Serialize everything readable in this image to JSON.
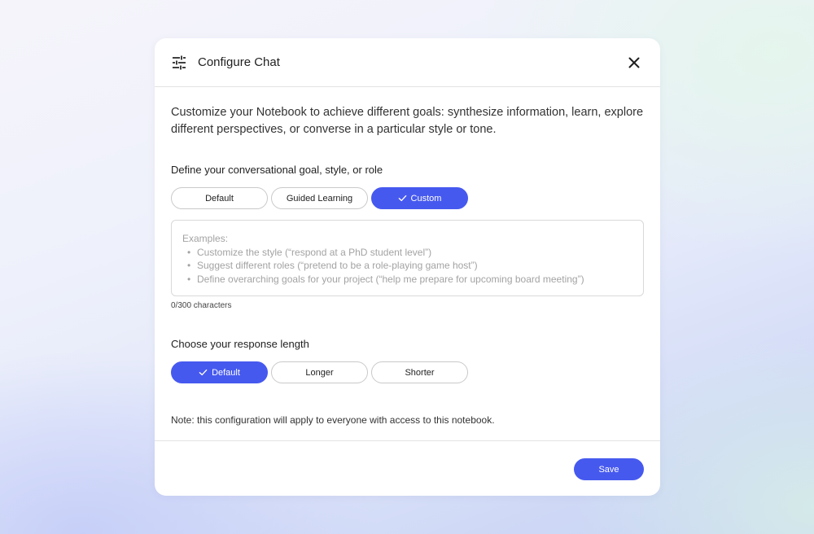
{
  "dialog": {
    "title": "Configure Chat",
    "icons": {
      "header": "tune-icon",
      "close": "close-icon",
      "selected": "check-icon"
    },
    "intro": "Customize your Notebook to achieve different goals: synthesize information, learn, explore different perspectives, or converse in a particular style or tone.",
    "goal": {
      "label": "Define your conversational goal, style, or role",
      "options": [
        {
          "label": "Default",
          "selected": false
        },
        {
          "label": "Guided Learning",
          "selected": false
        },
        {
          "label": "Custom",
          "selected": true
        }
      ],
      "textarea": {
        "value": "",
        "placeholder_heading": "Examples:",
        "placeholder_items": [
          "Customize the style (“respond at a PhD student level”)",
          "Suggest different roles (“pretend to be a role-playing game host”)",
          "Define overarching goals for your project (“help me prepare for upcoming board meeting”)"
        ]
      },
      "char_count": "0/300 characters"
    },
    "length": {
      "label": "Choose your response length",
      "options": [
        {
          "label": "Default",
          "selected": true
        },
        {
          "label": "Longer",
          "selected": false
        },
        {
          "label": "Shorter",
          "selected": false
        }
      ]
    },
    "note": "Note: this configuration will apply to everyone with access to this notebook.",
    "save_label": "Save"
  },
  "colors": {
    "accent": "#4659ef",
    "border": "#c9c9c9",
    "placeholder": "#a3a3a3"
  }
}
